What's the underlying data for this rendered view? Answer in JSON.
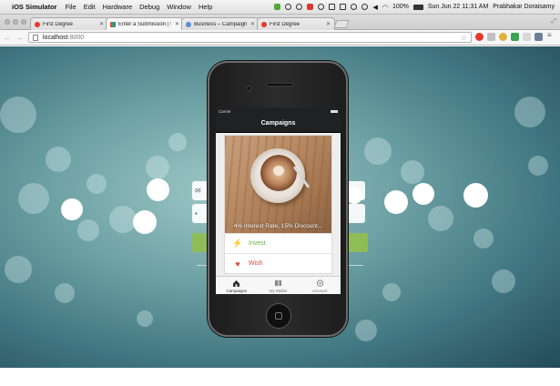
{
  "menubar": {
    "app_name": "iOS Simulator",
    "menus": [
      "File",
      "Edit",
      "Hardware",
      "Debug",
      "Window",
      "Help"
    ],
    "battery": "100%",
    "datetime": "Sun Jun 22  11:31 AM",
    "user": "Prabhakar Doraisamy"
  },
  "browser": {
    "tabs": [
      {
        "label": "First Degree",
        "icon": "opera-icon",
        "active": false
      },
      {
        "label": "Enter a Submission | Smal",
        "icon": "colorful-icon",
        "active": true
      },
      {
        "label": "Business – Campaign",
        "icon": "people-icon",
        "active": false
      },
      {
        "label": "First Degree",
        "icon": "opera-icon",
        "active": false
      }
    ],
    "url_host": "localhost",
    "url_port": ":8000"
  },
  "app": {
    "status_carrier": "Carrier",
    "nav_title": "Campaigns",
    "card_caption": "4% Interest Rate, 15% Discount...",
    "actions": [
      {
        "label": "Invest",
        "icon": "lightning-icon",
        "color": "#69b44c"
      },
      {
        "label": "Wish",
        "icon": "heart-icon",
        "color": "#e04a3c"
      }
    ],
    "tabs": [
      {
        "label": "Campaigns",
        "icon": "home-icon",
        "selected": true
      },
      {
        "label": "My Wallet",
        "icon": "wallet-icon",
        "selected": false
      },
      {
        "label": "Account",
        "icon": "account-icon",
        "selected": false
      }
    ]
  },
  "colors": {
    "accent_green": "#8ebd57",
    "nav_dark": "#202122"
  }
}
